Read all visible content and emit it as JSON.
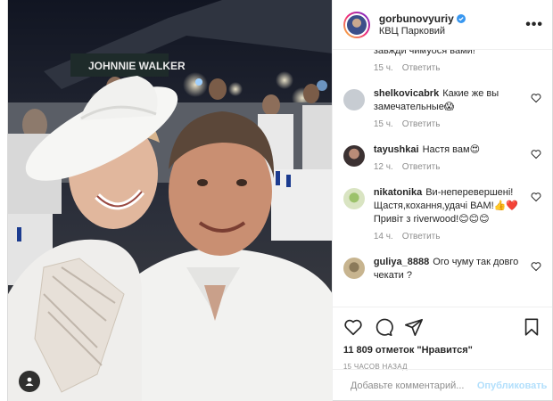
{
  "post": {
    "username": "gorbunovyuriy",
    "location": "КВЦ Парковий",
    "more_label": "•••"
  },
  "photo": {
    "sign_text": "JOHNNIE WALKER"
  },
  "comments": [
    {
      "user": "",
      "text": "завжди чимуося вами!",
      "time": "15 ч.",
      "reply": "Ответить",
      "likes": ""
    },
    {
      "user": "shelkovicabrk",
      "text": "Какие же вы замечательные😱",
      "time": "15 ч.",
      "reply": "Ответить",
      "likes": ""
    },
    {
      "user": "tayushkai",
      "text": "Настя вам😍",
      "time": "12 ч.",
      "reply": "Ответить",
      "likes": ""
    },
    {
      "user": "nikatonika",
      "text": "Ви-неперевершені! Щастя,кохання,удачі ВАМ!👍❤️ Привіт з riverwood!😊😊😊",
      "time": "14 ч.",
      "reply": "Ответить",
      "likes": ""
    },
    {
      "user": "guliya_8888",
      "text": "Ого чуму так довго чекати ?",
      "time": "",
      "reply": "",
      "likes": ""
    }
  ],
  "stats": {
    "likes_count": "11 809",
    "likes_suffix": "отметок \"Нравится\"",
    "time_ago": "15 ЧАСОВ НАЗАД"
  },
  "composer": {
    "placeholder": "Добавьте комментарий...",
    "publish_label": "Опубликовать"
  },
  "colors": {
    "verified": "#3897f0",
    "publish_disabled": "#b2dffc",
    "muted": "#8e8e8e"
  }
}
